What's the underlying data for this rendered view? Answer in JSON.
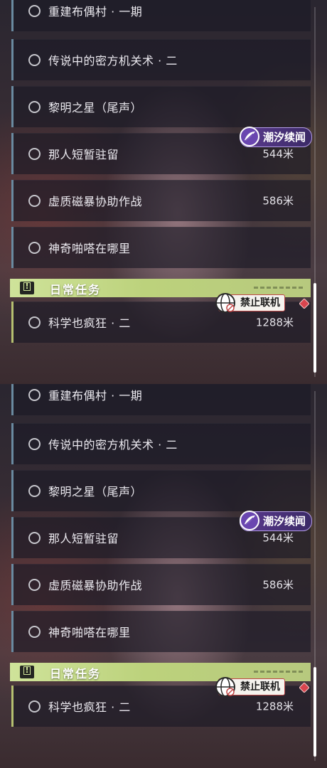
{
  "panels": [
    {
      "quests": [
        {
          "title": "重建布偶村 · 一期",
          "distance": ""
        },
        {
          "title": "传说中的密方机关术 · 二",
          "distance": ""
        },
        {
          "title": "黎明之星（尾声）",
          "distance": ""
        },
        {
          "title": "那人短暂驻留",
          "distance": "544米",
          "badge": "潮汐续闻"
        },
        {
          "title": "虚质磁暴协助作战",
          "distance": "586米"
        },
        {
          "title": "神奇啪嗒在哪里",
          "distance": ""
        }
      ],
      "section": {
        "label": "日常任务",
        "icon": "exclamation-icon"
      },
      "daily": {
        "title": "科学也疯狂 · 二",
        "distance": "1288米",
        "badge": "禁止联机"
      },
      "scroll_position": 0.76
    },
    {
      "quests": [
        {
          "title": "重建布偶村 · 一期",
          "distance": ""
        },
        {
          "title": "传说中的密方机关术 · 二",
          "distance": ""
        },
        {
          "title": "黎明之星（尾声）",
          "distance": ""
        },
        {
          "title": "那人短暂驻留",
          "distance": "544米",
          "badge": "潮汐续闻"
        },
        {
          "title": "虚质磁暴协助作战",
          "distance": "586米"
        },
        {
          "title": "神奇啪嗒在哪里",
          "distance": ""
        }
      ],
      "section": {
        "label": "日常任务",
        "icon": "exclamation-icon"
      },
      "daily": {
        "title": "科学也疯狂 · 二",
        "distance": "1288米",
        "badge": "禁止联机"
      },
      "scroll_position": 0.76
    }
  ],
  "colors": {
    "row_accent": "#6a8aa0",
    "daily_accent": "#b5c070",
    "section_header": "#c8dd8c",
    "tide_badge": "#5b3a8f",
    "offline_badge_border": "#c04848",
    "diamond": "#d8454e"
  },
  "icons": {
    "status": "empty-circle-icon",
    "tide": "tide-feather-icon",
    "offline": "globe-prohibited-icon",
    "marker": "red-diamond-icon"
  }
}
